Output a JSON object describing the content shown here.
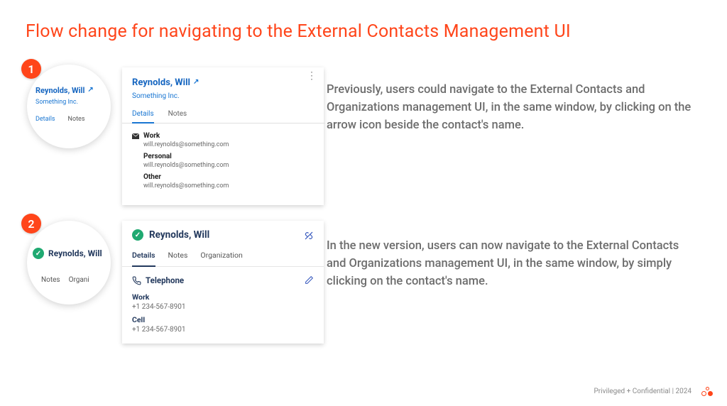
{
  "title": "Flow change for navigating to the External Contacts Management UI",
  "steps": [
    {
      "num": "1",
      "desc": "Previously, users could navigate to the External Contacts and Organizations management UI, in the same window, by clicking on the arrow icon beside the contact's name."
    },
    {
      "num": "2",
      "desc": "In the new version, users can now navigate to the External Contacts and Organizations management UI, in the same window, by simply clicking on the contact's name."
    }
  ],
  "card1": {
    "name": "Reynolds, Will",
    "org": "Something Inc.",
    "tabs": {
      "details": "Details",
      "notes": "Notes"
    },
    "emails": [
      {
        "label": "Work",
        "value": "will.reynolds@something.com"
      },
      {
        "label": "Personal",
        "value": "will.reynolds@something.com"
      },
      {
        "label": "Other",
        "value": "will.reynolds@something.com"
      }
    ]
  },
  "card2": {
    "name": "Reynolds, Will",
    "tabs": {
      "details": "Details",
      "notes": "Notes",
      "organization": "Organization"
    },
    "section": "Telephone",
    "phones": [
      {
        "label": "Work",
        "value": "+1 234-567-8901"
      },
      {
        "label": "Cell",
        "value": "+1 234-567-8901"
      }
    ]
  },
  "zoom2": {
    "tab_notes": "Notes",
    "tab_org_partial": "Organi"
  },
  "footer": "Privileged + Confidential  |  2024"
}
